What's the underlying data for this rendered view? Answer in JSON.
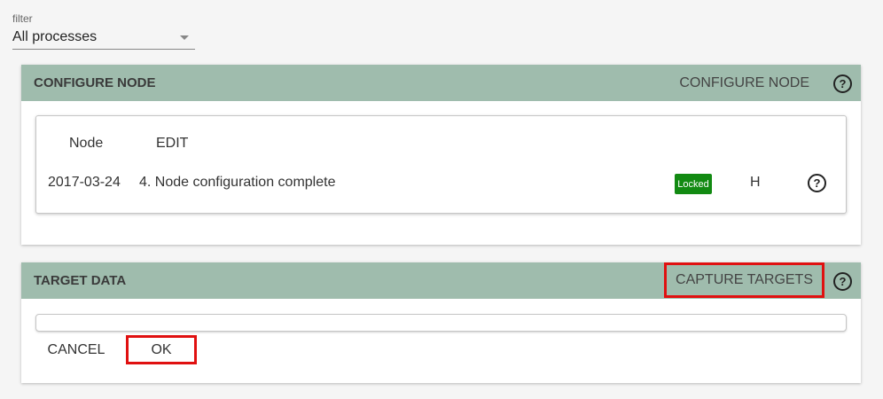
{
  "filter": {
    "label": "filter",
    "selected": "All processes"
  },
  "configure_node": {
    "title": "CONFIGURE NODE",
    "action_label": "CONFIGURE NODE",
    "help_glyph": "?",
    "table": {
      "col_node": "Node",
      "col_edit": "EDIT",
      "row": {
        "date": "2017-03-24",
        "description": "4. Node configuration complete",
        "status_badge": "Locked",
        "flag": "H",
        "help_glyph": "?"
      }
    }
  },
  "target_data": {
    "title": "TARGET DATA",
    "action_label": "CAPTURE TARGETS",
    "help_glyph": "?",
    "cancel_label": "CANCEL",
    "ok_label": "OK"
  },
  "colors": {
    "header_bg": "#9fbcad",
    "badge_green": "#128a12",
    "highlight_red": "#e01010"
  },
  "icons": {
    "help": "help-circle-icon",
    "dropdown": "chevron-down-icon"
  }
}
